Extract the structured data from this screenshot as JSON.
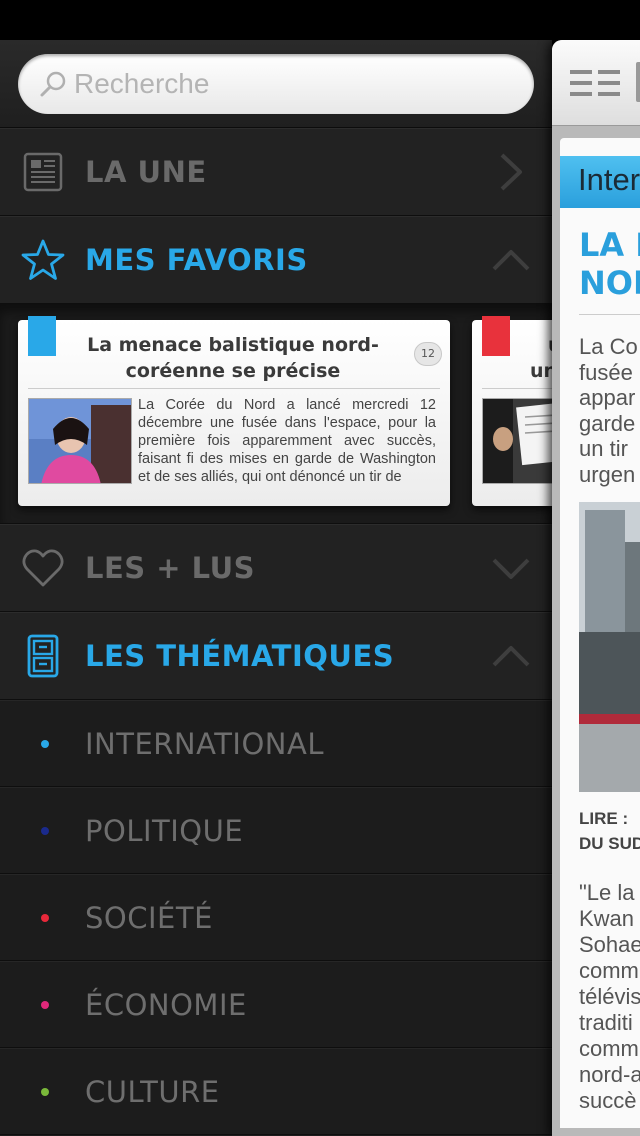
{
  "search": {
    "placeholder": "Recherche"
  },
  "sections": {
    "la_une": "LA UNE",
    "favoris": "MES FAVORIS",
    "plus_lus": "LES + LUS",
    "thematiques": "LES THÉMATIQUES"
  },
  "favorites": [
    {
      "title": "La menace balistique nord-coréenne se précise",
      "comments": "12",
      "tag_color": "#29a8e8",
      "excerpt": "La Corée du Nord a lancé mercredi 12 décembre une fusée dans l'espace, pour la première fois apparemment avec succès, faisant fi des mises en garde de Washington et de ses alliés, qui ont dénoncé un tir de"
    },
    {
      "title": "u",
      "title2": "un",
      "tag_color": "#e8323c"
    }
  ],
  "themes": [
    {
      "label": "INTERNATIONAL",
      "color": "#29a8e8"
    },
    {
      "label": "POLITIQUE",
      "color": "#1a2a8c"
    },
    {
      "label": "SOCIÉTÉ",
      "color": "#e8283a"
    },
    {
      "label": "ÉCONOMIE",
      "color": "#e0287a"
    },
    {
      "label": "CULTURE",
      "color": "#7ab83a"
    }
  ],
  "article": {
    "badge": "Inter",
    "headline": "LA M\nNOR",
    "lead": "La Co\nfusée\nappar\ngarde\nun tir\nurgen",
    "readmore": "LIRE :\nDU SUD",
    "body": "\"Le la\nKwan\nSohae\ncomm\ntélévis\ntraditi\ncomm\nnord-a\nsuccè"
  },
  "colors": {
    "accent": "#29a8e8",
    "muted": "#6a6a6a",
    "panel": "#1c1c1c"
  }
}
